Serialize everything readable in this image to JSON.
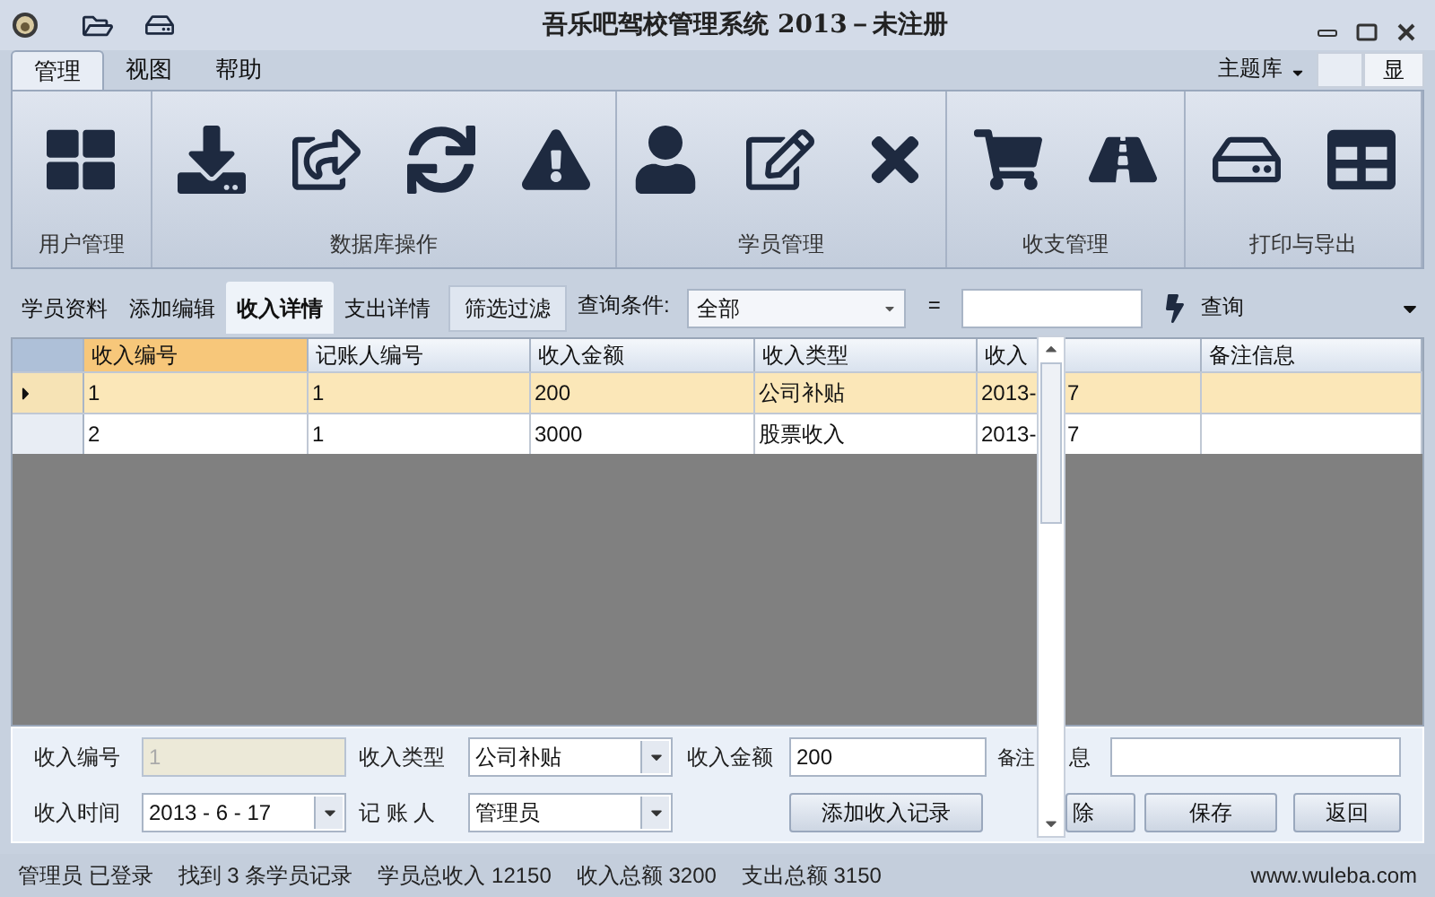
{
  "window": {
    "title": "吾乐吧驾校管理系统 2013－未注册"
  },
  "ribbon": {
    "tabs": [
      {
        "label": "管理",
        "selected": true
      },
      {
        "label": "视图",
        "selected": false
      },
      {
        "label": "帮助",
        "selected": false
      }
    ],
    "theme": {
      "label": "主题库",
      "button": "显"
    },
    "groups": [
      {
        "label": "用户管理"
      },
      {
        "label": "数据库操作"
      },
      {
        "label": "学员管理"
      },
      {
        "label": "收支管理"
      },
      {
        "label": "打印与导出"
      }
    ]
  },
  "subtabs": [
    {
      "label": "学员资料",
      "selected": false
    },
    {
      "label": "添加编辑",
      "selected": false
    },
    {
      "label": "收入详情",
      "selected": true
    },
    {
      "label": "支出详情",
      "selected": false
    }
  ],
  "filter_button": "筛选过滤",
  "query": {
    "label": "查询条件:",
    "condition": "全部",
    "equals": "=",
    "button": "查询"
  },
  "table": {
    "columns": [
      "收入编号",
      "记账人编号",
      "收入金额",
      "收入类型",
      "收入",
      "备注信息"
    ],
    "rows": [
      {
        "selected": true,
        "cells": [
          "1",
          "1",
          "200",
          "公司补贴",
          [
            "2013-",
            "7"
          ],
          ""
        ]
      },
      {
        "selected": false,
        "cells": [
          "2",
          "1",
          "3000",
          "股票收入",
          [
            "2013-",
            "7"
          ],
          ""
        ]
      }
    ]
  },
  "form": {
    "fields": [
      {
        "label": [
          "收入编号"
        ],
        "value": "1",
        "kind": "readonly"
      },
      {
        "label": [
          "收入类型"
        ],
        "value": "公司补贴",
        "kind": "select"
      },
      {
        "label": [
          "收入金额"
        ],
        "value": "200",
        "kind": "input"
      },
      {
        "label": [
          "备注",
          "息"
        ],
        "kind": "input"
      },
      {
        "label": [
          "收入时间"
        ],
        "value": "2013 - 6 - 17",
        "kind": "date"
      },
      {
        "label": [
          "记 账 人"
        ],
        "value": "管理员",
        "kind": "select"
      }
    ],
    "buttons": [
      "添加收入记录",
      "除",
      "保存",
      "返回"
    ]
  },
  "status_bar": {
    "items": [
      "管理员 已登录",
      "找到 3 条学员记录",
      "学员总收入 12150",
      "收入总额 3200",
      "支出总额 3150"
    ],
    "website": "www.wuleba.com"
  }
}
